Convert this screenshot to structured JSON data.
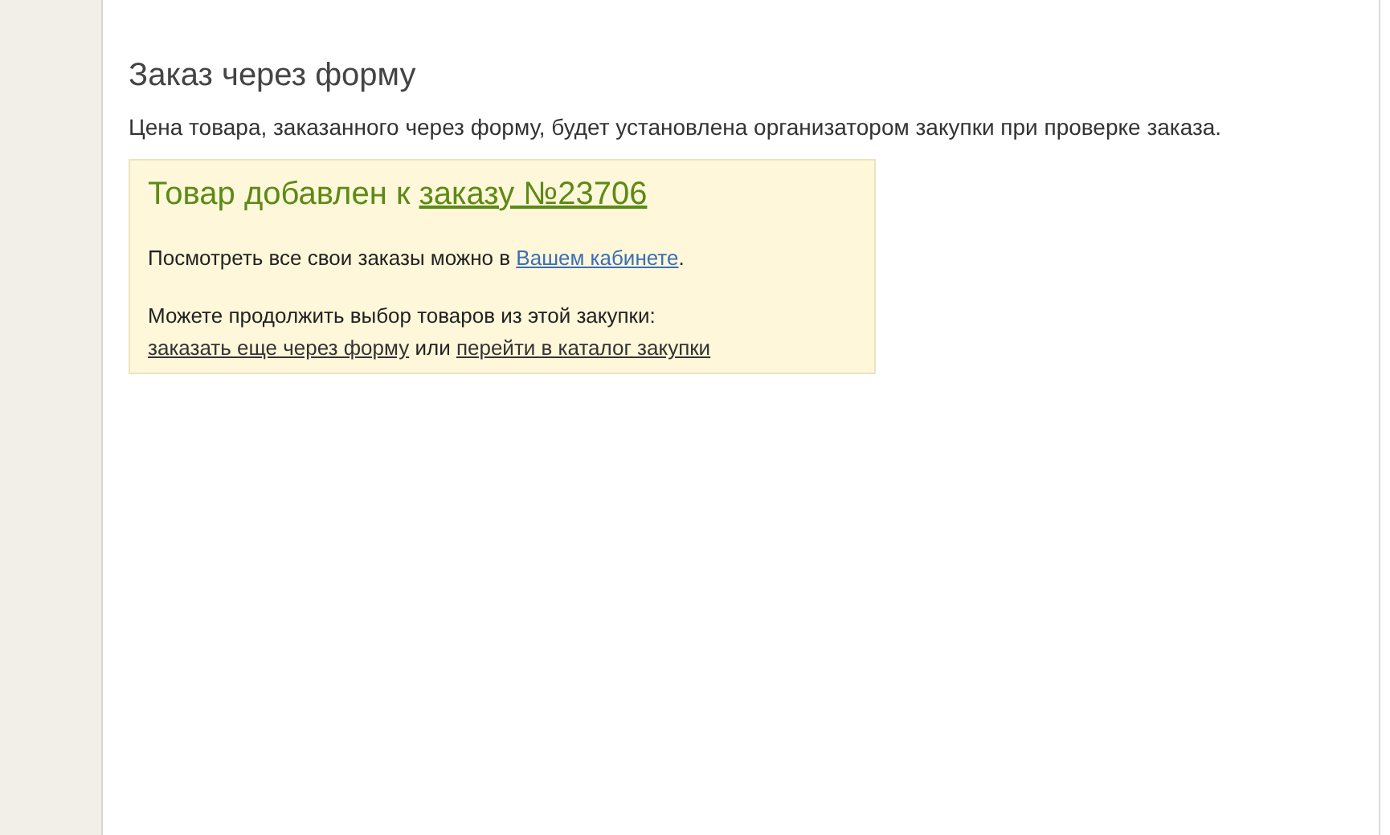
{
  "heading": "Заказ через форму",
  "note": "Цена товара, заказанного через форму, будет установлена организатором закупки при проверке заказа.",
  "notice": {
    "title": {
      "text": "Товар добавлен к",
      "link": "заказу №23706"
    },
    "cabinet": {
      "text": "Посмотреть все свои заказы можно в",
      "link": "Вашем кабинете",
      "after": "."
    },
    "continue_text": "Можете продолжить выбор товаров из этой закупки:",
    "continue_links": {
      "first": "заказать еще через форму",
      "between": "или",
      "second": "перейти в каталог закупки"
    }
  }
}
